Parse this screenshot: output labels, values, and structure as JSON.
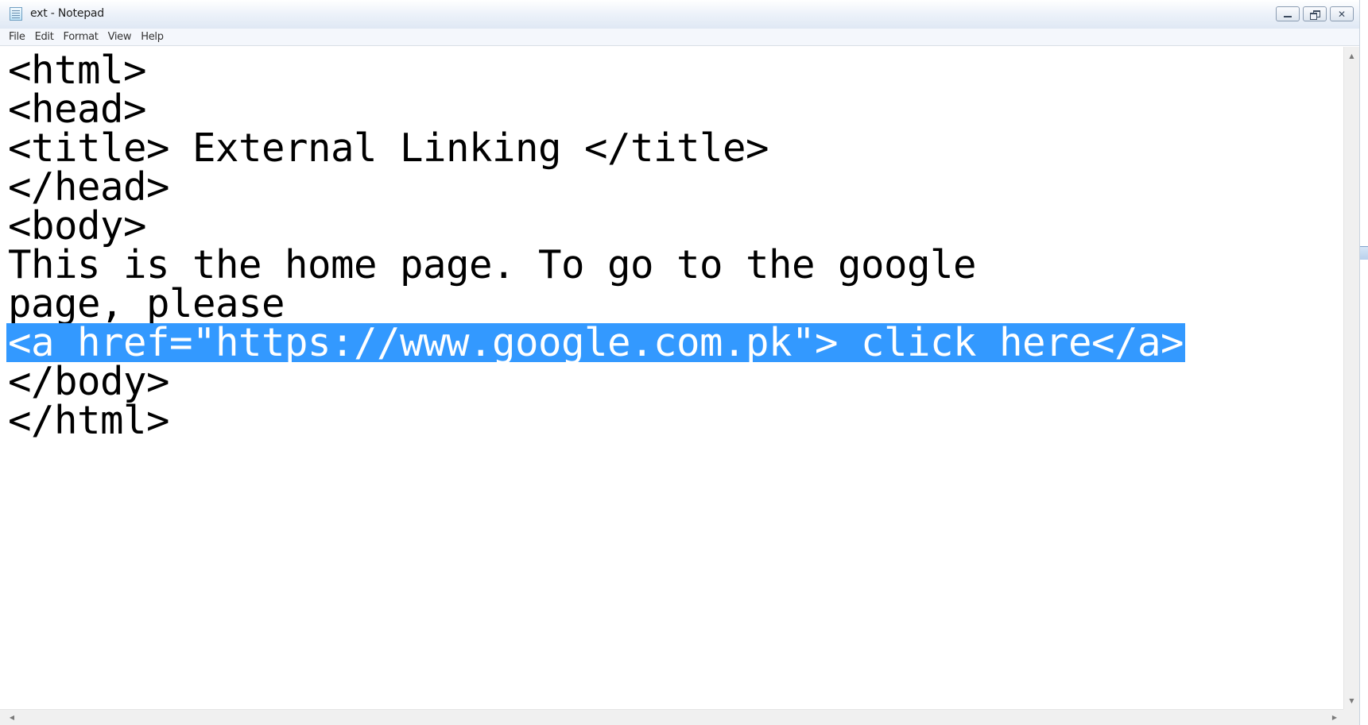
{
  "window": {
    "title": "ext - Notepad",
    "app_icon": "notepad-icon",
    "buttons": {
      "minimize_icon": "minimize-icon",
      "restore_icon": "restore-icon",
      "close_icon": "close-icon",
      "close_glyph": "✕"
    }
  },
  "menu": {
    "items": [
      "File",
      "Edit",
      "Format",
      "View",
      "Help"
    ]
  },
  "editor": {
    "lines": [
      "<html>",
      "<head>",
      "<title> External Linking </title>",
      "</head>",
      "<body>",
      "This is the home page. To go to the google",
      "page, please",
      "<a href=\"https://www.google.com.pk\"> click here</a>",
      "</body>",
      "</html>"
    ],
    "selected_line_index": 7,
    "selection_color": "#3399ff"
  },
  "scrollbars": {
    "up_arrow": "▲",
    "down_arrow": "▼",
    "left_arrow": "◀",
    "right_arrow": "▶"
  }
}
